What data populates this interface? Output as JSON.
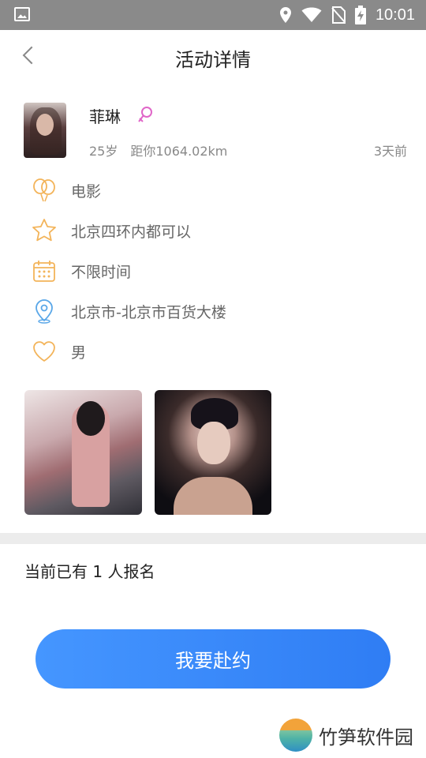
{
  "status_bar": {
    "time": "10:01",
    "icons": [
      "image-icon",
      "location-icon",
      "wifi-icon",
      "no-sim-icon",
      "battery-charging-icon"
    ]
  },
  "header": {
    "title": "活动详情",
    "back_icon": "chevron-left-icon"
  },
  "profile": {
    "name": "菲琳",
    "gender_icon": "female-icon",
    "age": "25岁",
    "distance": "距你1064.02km",
    "posted_ago": "3天前"
  },
  "details": [
    {
      "icon": "balloon-icon",
      "text": "电影"
    },
    {
      "icon": "star-icon",
      "text": "北京四环内都可以"
    },
    {
      "icon": "calendar-icon",
      "text": "不限时间"
    },
    {
      "icon": "location-pin-icon",
      "text": "北京市-北京市百货大楼"
    },
    {
      "icon": "heart-icon",
      "text": "男"
    }
  ],
  "photos_count": 2,
  "signup_text": "当前已有 1 人报名",
  "join_button": "我要赴约",
  "watermark": {
    "text": "竹笋软件园"
  },
  "colors": {
    "accent": "#2f7df4",
    "icon_orange": "#f3b45a",
    "icon_blue": "#5aa7e8",
    "status_bar": "#8a8a8a"
  }
}
